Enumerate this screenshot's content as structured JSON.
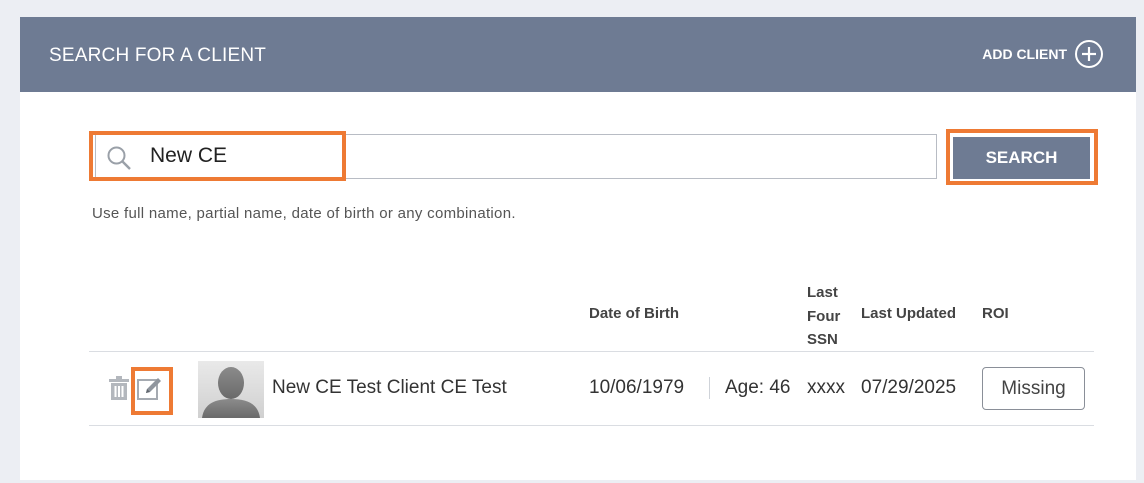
{
  "header": {
    "title": "SEARCH FOR A CLIENT",
    "add_client_label": "ADD CLIENT",
    "add_icon": "plus-circle-icon"
  },
  "search": {
    "value": "New CE",
    "icon": "search-icon",
    "button_label": "SEARCH",
    "hint": "Use full name, partial name, date of birth or any combination."
  },
  "results": {
    "columns": {
      "dob": "Date of Birth",
      "ssn": "Last Four SSN",
      "updated": "Last Updated",
      "roi": "ROI"
    },
    "rows": [
      {
        "name": "New CE Test Client CE Test",
        "dob": "10/06/1979",
        "age": "Age: 46",
        "ssn": "xxxx",
        "updated": "07/29/2025",
        "roi": "Missing"
      }
    ]
  },
  "colors": {
    "header_bg": "#6e7b93",
    "highlight": "#ee7a34"
  }
}
